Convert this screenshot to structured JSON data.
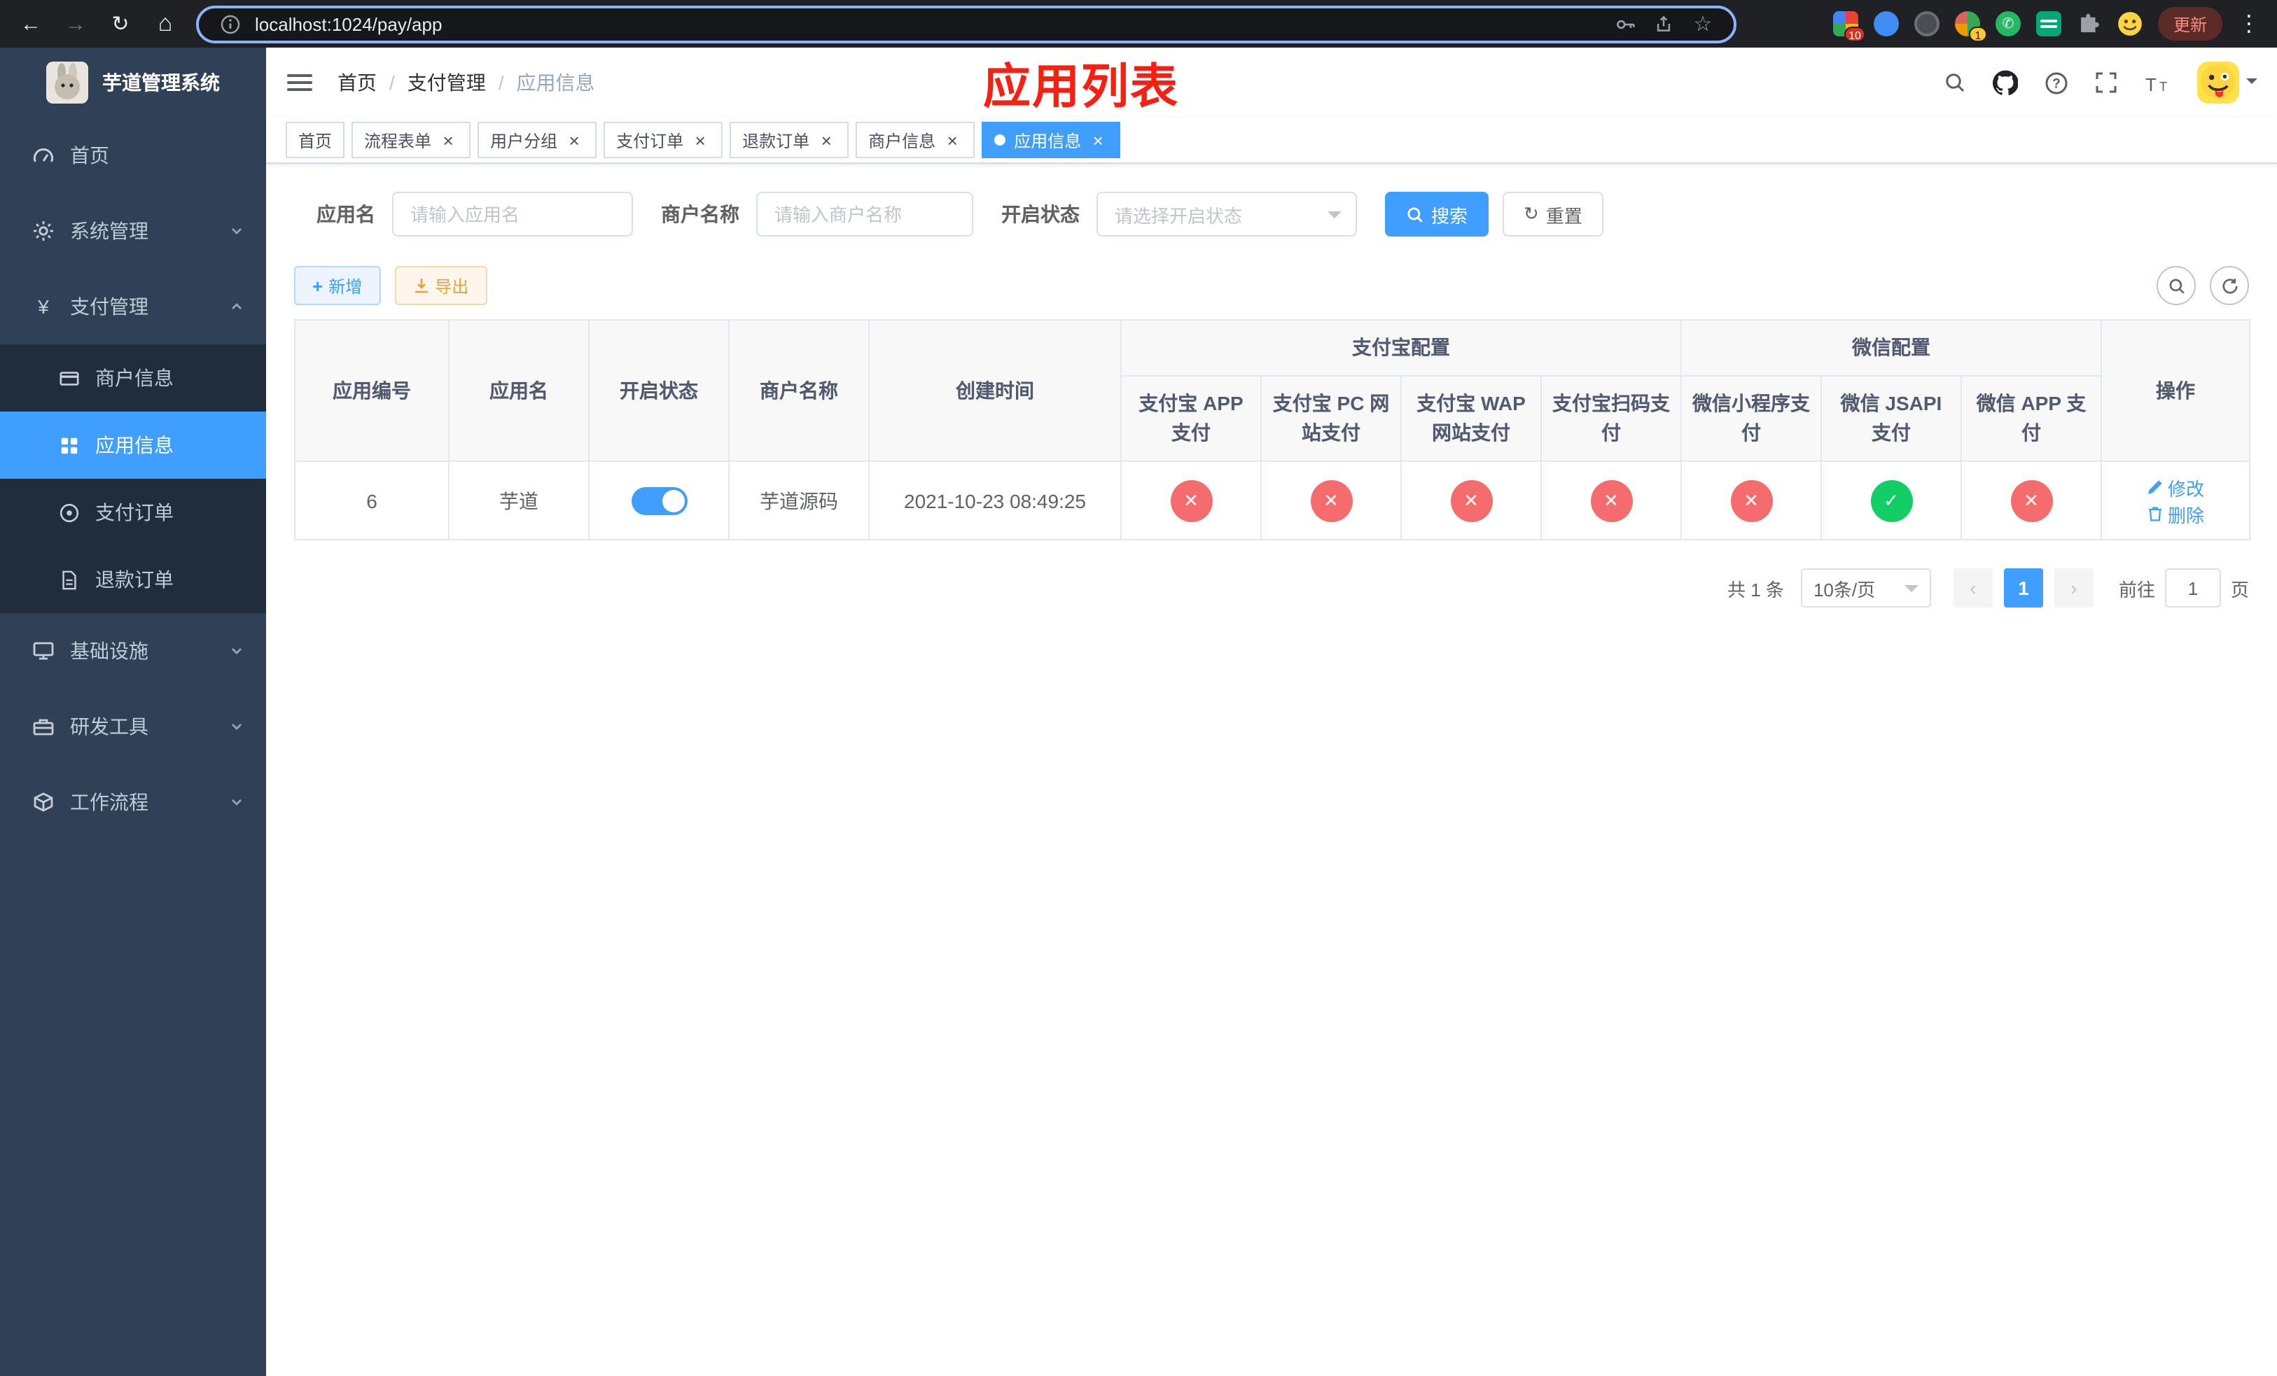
{
  "browser": {
    "url": "localhost:1024/pay/app",
    "update_label": "更新",
    "ext_badge_a": "10",
    "ext_badge_b": "1"
  },
  "sidebar": {
    "title": "芋道管理系统",
    "menu": [
      {
        "label": "首页"
      },
      {
        "label": "系统管理"
      },
      {
        "label": "支付管理"
      },
      {
        "label": "基础设施"
      },
      {
        "label": "研发工具"
      },
      {
        "label": "工作流程"
      }
    ],
    "submenu_pay": [
      {
        "label": "商户信息"
      },
      {
        "label": "应用信息"
      },
      {
        "label": "支付订单"
      },
      {
        "label": "退款订单"
      }
    ]
  },
  "navbar": {
    "breadcrumb": [
      "首页",
      "支付管理",
      "应用信息"
    ],
    "annotation": "应用列表"
  },
  "tabs": [
    {
      "label": "首页"
    },
    {
      "label": "流程表单"
    },
    {
      "label": "用户分组"
    },
    {
      "label": "支付订单"
    },
    {
      "label": "退款订单"
    },
    {
      "label": "商户信息"
    },
    {
      "label": "应用信息"
    }
  ],
  "filter": {
    "app_name_label": "应用名",
    "app_name_placeholder": "请输入应用名",
    "merchant_label": "商户名称",
    "merchant_placeholder": "请输入商户名称",
    "status_label": "开启状态",
    "status_placeholder": "请选择开启状态",
    "search": "搜索",
    "reset": "重置"
  },
  "actions": {
    "add": "新增",
    "export": "导出"
  },
  "table": {
    "headers": {
      "app_id": "应用编号",
      "app_name": "应用名",
      "status": "开启状态",
      "merchant": "商户名称",
      "created": "创建时间",
      "alipay_group": "支付宝配置",
      "wechat_group": "微信配置",
      "alipay_app": "支付宝 APP 支付",
      "alipay_pc": "支付宝 PC 网站支付",
      "alipay_wap": "支付宝 WAP 网站支付",
      "alipay_qr": "支付宝扫码支付",
      "wx_mini": "微信小程序支付",
      "wx_jsapi": "微信 JSAPI 支付",
      "wx_app": "微信 APP 支付",
      "actions": "操作"
    },
    "row": {
      "id": "6",
      "name": "芋道",
      "switch": "on",
      "merchant": "芋道源码",
      "created": "2021-10-23 08:49:25",
      "statuses": [
        "no",
        "no",
        "no",
        "no",
        "no",
        "yes",
        "no"
      ],
      "edit": "修改",
      "delete": "删除"
    }
  },
  "pagination": {
    "total": "共 1 条",
    "page_size": "10条/页",
    "prev": "‹",
    "page": "1",
    "next": "›",
    "goto": "前往",
    "goto_value": "1",
    "unit": "页"
  },
  "colors": {
    "primary": "#409eff",
    "danger": "#f56c6c",
    "success": "#13ce66",
    "sidebar": "#304156",
    "annotation": "#fb1f11"
  }
}
